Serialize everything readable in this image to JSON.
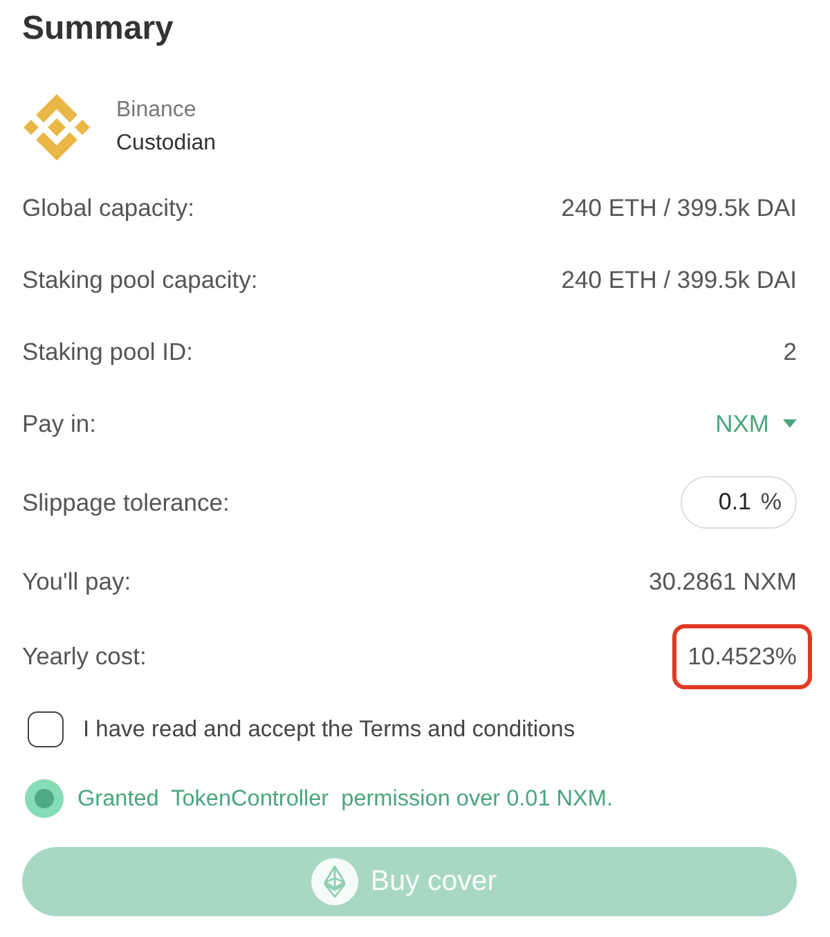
{
  "title": "Summary",
  "provider": {
    "name": "Binance",
    "type": "Custodian"
  },
  "details": [
    {
      "kind": "text",
      "label": "Global capacity:",
      "value": "240 ETH / 399.5k DAI",
      "highlighted": false
    },
    {
      "kind": "text",
      "label": "Staking pool capacity:",
      "value": "240 ETH / 399.5k DAI",
      "highlighted": false
    },
    {
      "kind": "text",
      "label": "Staking pool ID:",
      "value": "2",
      "highlighted": false
    },
    {
      "kind": "select",
      "label": "Pay in:",
      "value": "NXM",
      "highlighted": false
    },
    {
      "kind": "input",
      "label": "Slippage tolerance:",
      "value": "0.1",
      "unit": "%",
      "highlighted": false
    },
    {
      "kind": "text",
      "label": "You'll pay:",
      "value": "30.2861 NXM",
      "highlighted": false
    },
    {
      "kind": "text",
      "label": "Yearly cost:",
      "value": "10.4523%",
      "highlighted": true
    }
  ],
  "terms": {
    "label": "I have read and accept the Terms and conditions",
    "checked": false
  },
  "permission": {
    "text": "Granted  TokenController  permission over 0.01 NXM.",
    "granted": true
  },
  "buy_button": {
    "label": "Buy cover",
    "disabled": true
  }
}
